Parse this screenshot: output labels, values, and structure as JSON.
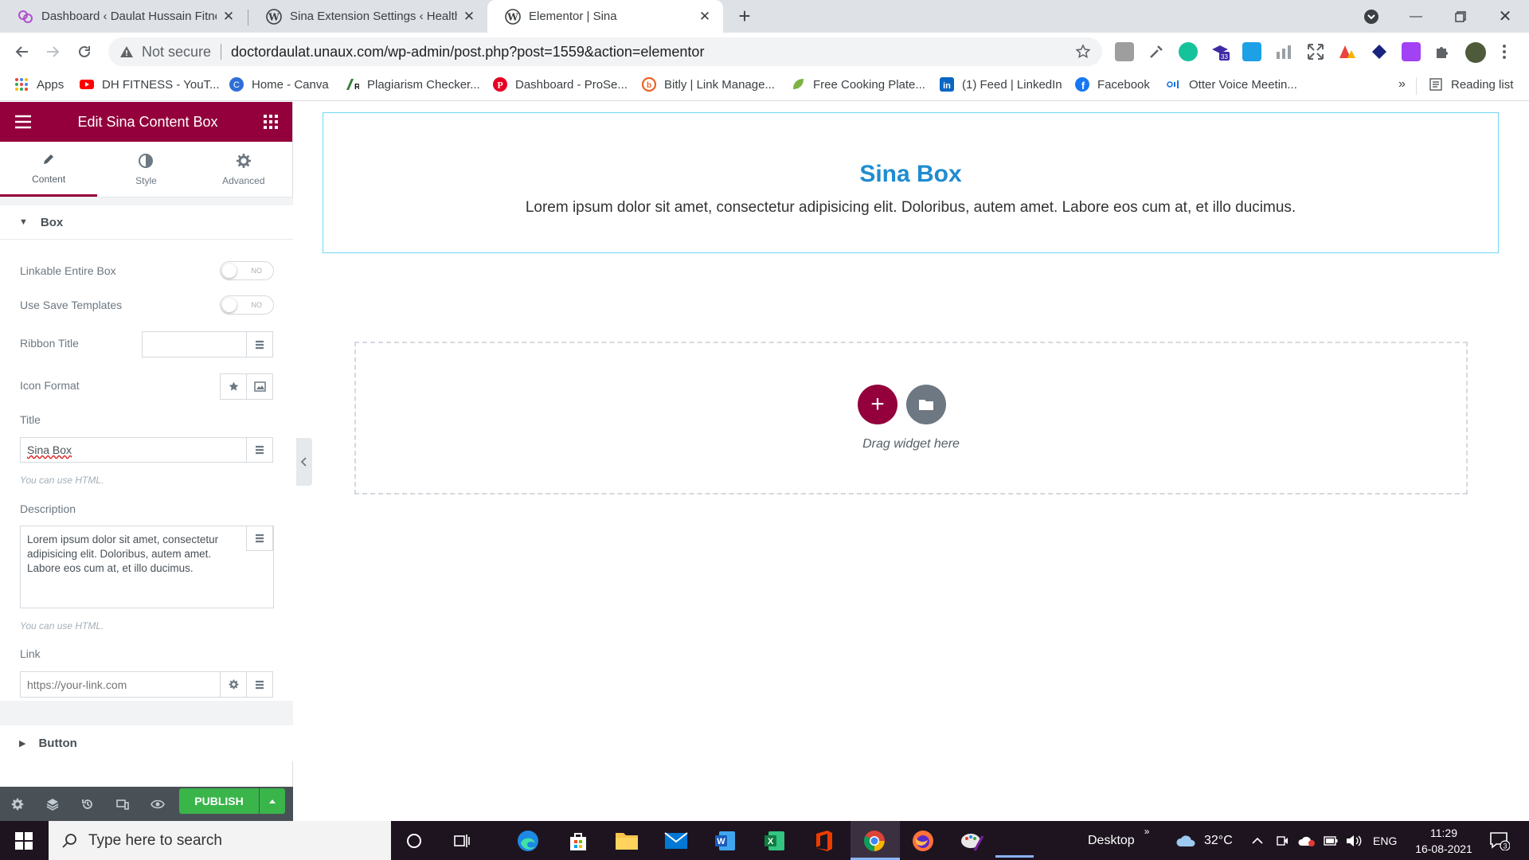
{
  "browser": {
    "tabs": [
      {
        "title": "Dashboard ‹ Daulat Hussain Fitne",
        "active": false
      },
      {
        "title": "Sina Extension Settings ‹ Health &",
        "active": false
      },
      {
        "title": "Elementor | Sina",
        "active": true
      }
    ],
    "address": {
      "security_label": "Not secure",
      "url": "doctordaulat.unaux.com/wp-admin/post.php?post=1559&action=elementor"
    },
    "bookmarks": [
      "Apps",
      "DH FITNESS - YouT...",
      "Home - Canva",
      "Plagiarism Checker...",
      "Dashboard - ProSe...",
      "Bitly | Link Manage...",
      "Free Cooking Plate...",
      "(1) Feed | LinkedIn",
      "Facebook",
      "Otter Voice Meetin..."
    ],
    "reading_list": "Reading list",
    "extension_badge": "33"
  },
  "panel": {
    "title": "Edit Sina Content Box",
    "tabs": [
      {
        "label": "Content",
        "icon": "pencil-icon"
      },
      {
        "label": "Style",
        "icon": "half-circle-icon"
      },
      {
        "label": "Advanced",
        "icon": "gear-icon"
      }
    ],
    "section_box": "Box",
    "linkable_label": "Linkable Entire Box",
    "save_templates_label": "Use Save Templates",
    "toggle_off": "NO",
    "ribbon_label": "Ribbon Title",
    "ribbon_value": "",
    "icon_format_label": "Icon Format",
    "title_label": "Title",
    "title_value": "Sina Box",
    "html_hint": "You can use HTML.",
    "description_label": "Description",
    "description_value": "Lorem ipsum dolor sit amet, consectetur adipisicing elit. Doloribus, autem amet. Labore eos cum at, et illo ducimus.",
    "link_label": "Link",
    "link_placeholder": "https://your-link.com",
    "section_button": "Button",
    "publish": "PUBLISH"
  },
  "canvas": {
    "box_title": "Sina Box",
    "box_desc": "Lorem ipsum dolor sit amet, consectetur adipisicing elit. Doloribus, autem amet. Labore eos cum at, et illo ducimus.",
    "drop_text": "Drag widget here",
    "add_symbol": "+"
  },
  "taskbar": {
    "search_placeholder": "Type here to search",
    "desktop": "Desktop",
    "temperature": "32°C",
    "lang": "ENG",
    "time": "11:29",
    "date": "16-08-2021",
    "notifications": "3"
  },
  "colors": {
    "elementor_accent": "#93003c",
    "publish_green": "#39b54a",
    "sina_title": "#1f8ccf",
    "box_border": "#71d7f7"
  }
}
